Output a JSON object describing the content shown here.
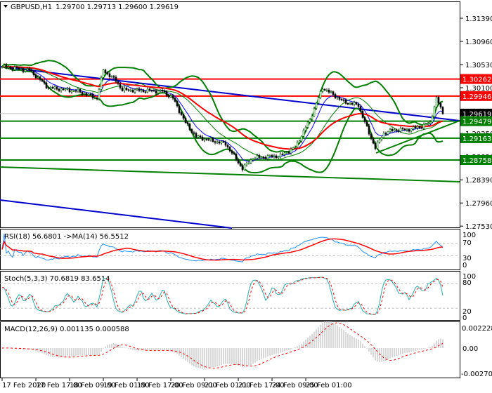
{
  "header": {
    "symbol": "GBPUSD,H1",
    "ohlc": "1.29700 1.29713 1.29600 1.29619"
  },
  "price_axis": [
    "1.31390",
    "1.30960",
    "1.30530",
    "1.30100",
    "1.29670",
    "1.29250",
    "1.28820",
    "1.28390",
    "1.27960",
    "1.27530"
  ],
  "price_tags": [
    {
      "value": "1.30262",
      "color": "#ff0000"
    },
    {
      "value": "1.29946",
      "color": "#ff0000"
    },
    {
      "value": "1.29619",
      "color": "#000000"
    },
    {
      "value": "1.29479",
      "color": "#008000"
    },
    {
      "value": "1.29163",
      "color": "#008000"
    },
    {
      "value": "1.28758",
      "color": "#008000"
    }
  ],
  "rsi": {
    "label": "RSI(18) 56.6801  ->MA(14) 56.5512",
    "axis": [
      "100",
      "70",
      "30",
      "0"
    ]
  },
  "stoch": {
    "label": "Stoch(5,3,3) 70.6819 83.6514",
    "axis": [
      "100",
      "80",
      "20",
      "0"
    ]
  },
  "macd": {
    "label": "MACD(12,26,9) 0.001135 0.000588",
    "axis": [
      "0.002228",
      "0.00",
      "-0.002707"
    ]
  },
  "time_axis": [
    "17 Feb 2020",
    "17 Feb 17:00",
    "18 Feb 09:00",
    "19 Feb 01:00",
    "19 Feb 17:00",
    "20 Feb 09:00",
    "21 Feb 01:00",
    "21 Feb 17:00",
    "24 Feb 09:00",
    "25 Feb 01:00"
  ],
  "chart_data": {
    "type": "candlestick",
    "ylim": [
      1.2753,
      1.3139
    ],
    "key_path": [
      [
        0,
        1.30491
      ],
      [
        13,
        1.30426
      ],
      [
        22,
        1.301
      ],
      [
        36,
        1.30035
      ],
      [
        45,
        1.29905
      ],
      [
        48,
        1.30426
      ],
      [
        54,
        1.3023
      ],
      [
        57,
        1.30061
      ],
      [
        76,
        1.30035
      ],
      [
        81,
        1.29905
      ],
      [
        87,
        1.29449
      ],
      [
        92,
        1.29188
      ],
      [
        106,
        1.29058
      ],
      [
        114,
        1.28602
      ],
      [
        119,
        1.28797
      ],
      [
        132,
        1.28836
      ],
      [
        139,
        1.28993
      ],
      [
        146,
        1.29514
      ],
      [
        152,
        1.301
      ],
      [
        157,
        1.2997
      ],
      [
        162,
        1.2984
      ],
      [
        169,
        1.29774
      ],
      [
        174,
        1.29253
      ],
      [
        177,
        1.28993
      ],
      [
        181,
        1.29253
      ],
      [
        186,
        1.29318
      ],
      [
        192,
        1.29318
      ],
      [
        199,
        1.29384
      ],
      [
        203,
        1.29449
      ],
      [
        206,
        1.29905
      ],
      [
        209,
        1.29619
      ]
    ],
    "levels": {
      "red": [
        1.30262,
        1.29946
      ],
      "green": [
        1.29479,
        1.29163,
        1.28758
      ],
      "bid": 1.29619
    }
  }
}
